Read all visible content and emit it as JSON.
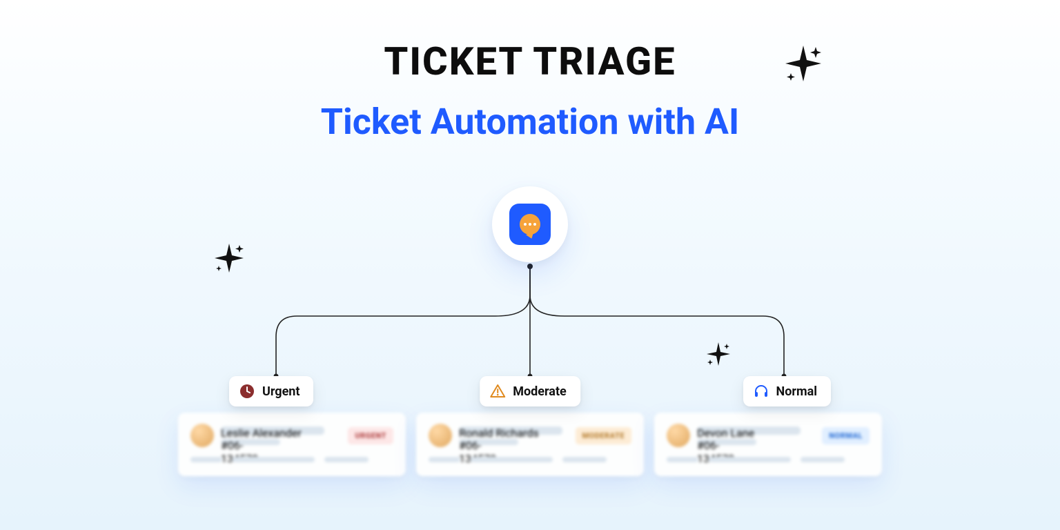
{
  "heading": {
    "title": "TICKET TRIAGE",
    "subtitle": "Ticket Automation with AI"
  },
  "hub": {
    "icon_name": "chat-ai-logo"
  },
  "priorities": {
    "urgent": {
      "label": "Urgent",
      "icon": "clock-icon",
      "badge": "URGENT"
    },
    "moderate": {
      "label": "Moderate",
      "icon": "warning-icon",
      "badge": "MODERATE"
    },
    "normal": {
      "label": "Normal",
      "icon": "headset-icon",
      "badge": "NORMAL"
    }
  },
  "cards": {
    "urgent": {
      "name": "Leslie Alexander",
      "id": "#06-134578"
    },
    "moderate": {
      "name": "Ronald Richards",
      "id": "#06-134578"
    },
    "normal": {
      "name": "Devon Lane",
      "id": "#06-134578"
    }
  },
  "decor": {
    "sparkle": "sparkle-icon"
  },
  "colors": {
    "accent_blue": "#1f5bff",
    "urgent": "#b04242",
    "moderate": "#b57d2f",
    "normal": "#2a6fd6"
  }
}
